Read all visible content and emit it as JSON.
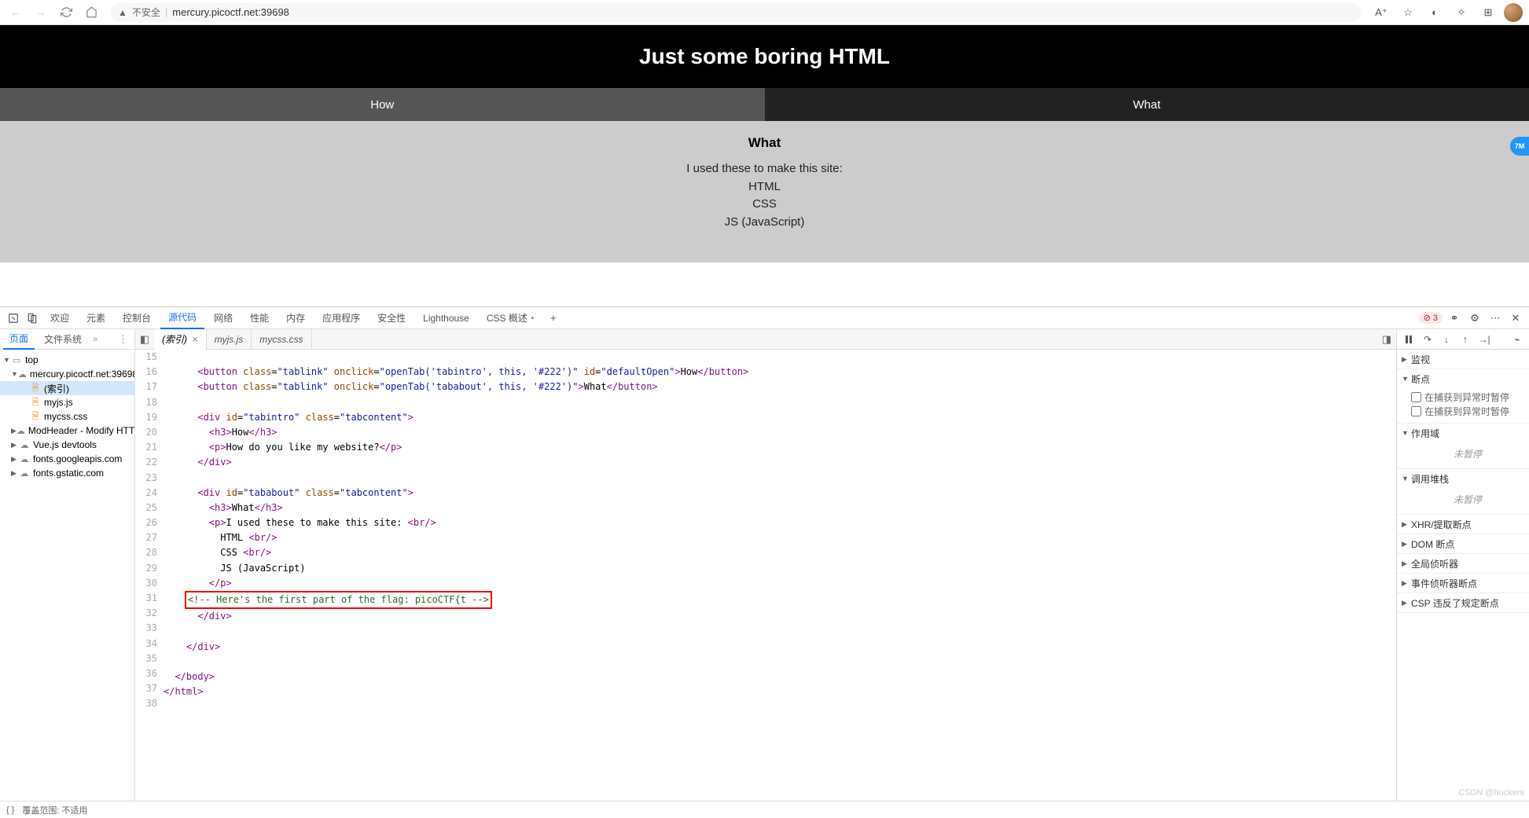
{
  "browser": {
    "security_text": "不安全",
    "url": "mercury.picoctf.net:39698",
    "float_badge": "7M"
  },
  "page": {
    "title": "Just some boring HTML",
    "tabs": {
      "how": "How",
      "what": "What"
    },
    "content_heading": "What",
    "content_intro": "I used these to make this site:",
    "line1": "HTML",
    "line2": "CSS",
    "line3": "JS (JavaScript)"
  },
  "devtools": {
    "tabs": {
      "welcome": "欢迎",
      "elements": "元素",
      "console": "控制台",
      "sources": "源代码",
      "network": "网络",
      "performance": "性能",
      "memory": "内存",
      "application": "应用程序",
      "security": "安全性",
      "lighthouse": "Lighthouse",
      "cssoverview": "CSS 概述"
    },
    "error_count": "3",
    "sidebar_tabs": {
      "page": "页面",
      "filesystem": "文件系统"
    },
    "tree": {
      "top": "top",
      "domain": "mercury.picoctf.net:39698",
      "index": "(索引)",
      "myjs": "myjs.js",
      "mycss": "mycss.css",
      "modheader": "ModHeader - Modify HTTP hea",
      "vuedev": "Vue.js devtools",
      "gfonts": "fonts.googleapis.com",
      "gstatic": "fonts.gstatic.com"
    },
    "editor_tabs": {
      "index": "(索引)",
      "myjs": "myjs.js",
      "mycss": "mycss.css"
    },
    "code_start_line": 15,
    "debugger": {
      "watch": "监视",
      "breakpoints": "断点",
      "bp1": "在捕获到异常时暂停",
      "bp2": "在捕获到异常时暂停",
      "scope": "作用域",
      "not_paused": "未暂停",
      "callstack": "调用堆栈",
      "xhr": "XHR/提取断点",
      "dom": "DOM 断点",
      "global": "全局侦听器",
      "event": "事件侦听器断点",
      "csp": "CSP 违反了规定断点"
    },
    "status": {
      "brackets": "{ }",
      "coverage": "覆盖范围: 不适用"
    }
  },
  "watermark": "CSDN @huckers"
}
